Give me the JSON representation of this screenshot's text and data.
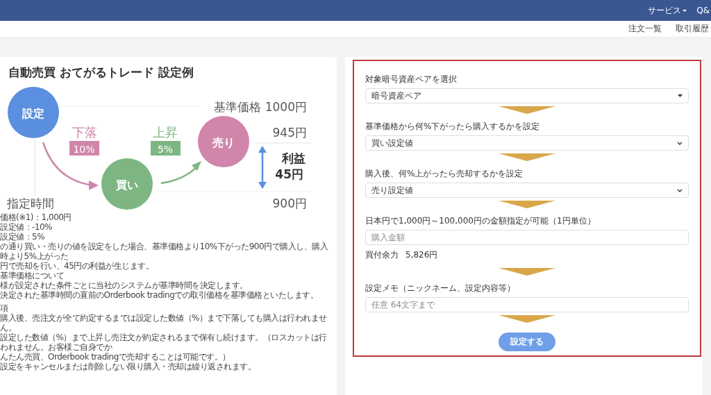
{
  "nav": {
    "items": [
      {
        "label": "サービス",
        "dropdown": true
      },
      {
        "label": "Q&",
        "dropdown": false
      }
    ]
  },
  "sub_nav": {
    "items": [
      {
        "label": "注文一覧"
      },
      {
        "label": "取引履歴"
      }
    ]
  },
  "diagram": {
    "title": "自動売買 おてがるトレード 設定例",
    "setting": "設定",
    "time": "指定時間",
    "drop_label": "下落",
    "drop_value": "10%",
    "rise_label": "上昇",
    "rise_value": "5%",
    "sell": "売り",
    "buy": "買い",
    "base_price": "基準価格 1000円",
    "sell_price": "945円",
    "profit_label": "利益",
    "profit_value": "45円",
    "buy_price": "900円"
  },
  "notes": [
    {
      "lines": [
        "価格(※1)：1,000円",
        "設定値：-10%",
        "設定値：5%",
        "の通り買い・売りの値を設定をした場合、基準価格より10%下がった900円で購入し、購入時より5%上がった",
        "円で売却を行い、45円の利益が生じます。",
        "基準価格について",
        "様が設定された条件ごとに当社のシステムが基準時間を決定します。",
        "決定された基準時間の直前のOrderbook tradingでの取引価格を基準価格といたします。"
      ]
    },
    {
      "lines": [
        "項",
        "購入後、売注文が全て約定するまでは設定した数値（%）まで下落しても購入は行われません。",
        "設定した数値（%）まで上昇し売注文が約定されるまで保有し続けます。（ロスカットは行われません。お客様ご自身でか",
        "んたん売買、Orderbook tradingで売却することは可能です。）",
        "設定をキャンセルまたは削除しない限り購入・売却は繰り返されます。"
      ]
    }
  ],
  "form": {
    "steps": [
      {
        "kind": "dropdown",
        "label": "対象暗号資産ペアを選択",
        "value": "暗号資産ペア"
      },
      {
        "kind": "select",
        "label": "基準価格から何%下がったら購入するかを設定",
        "value": "買い設定値"
      },
      {
        "kind": "select",
        "label": "購入後、何%上がったら売却するかを設定",
        "value": "売り設定値"
      },
      {
        "kind": "input",
        "label": "日本円で1,000円～100,000円の金額指定が可能（1円単位）",
        "placeholder": "購入金額",
        "balance_label": "買付余力",
        "balance_value": "5,826円"
      },
      {
        "kind": "input",
        "label": "設定メモ（ニックネーム、設定内容等）",
        "placeholder": "任意 64文字まで"
      }
    ],
    "submit": "設定する"
  }
}
